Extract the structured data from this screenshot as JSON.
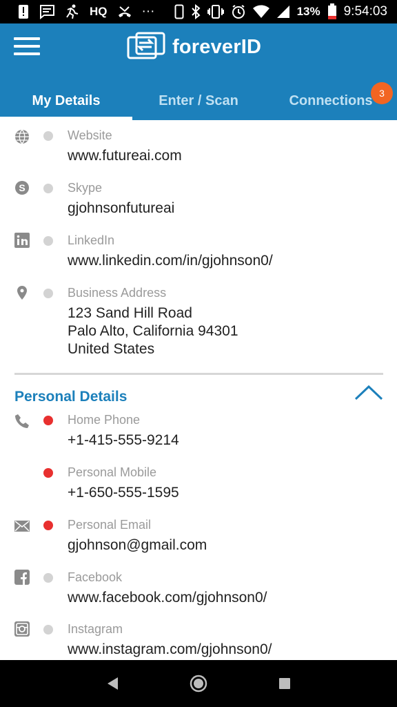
{
  "status_bar": {
    "left_icons": [
      "alert-icon",
      "message-icon",
      "activity-icon"
    ],
    "hq": "HQ",
    "ellipsis": "···",
    "battery_percent": "13%",
    "time": "9:54:03"
  },
  "app": {
    "logo_text": "foreverID",
    "brand_color": "#1c80bb",
    "tabs": [
      {
        "label": "My Details",
        "active": true
      },
      {
        "label": "Enter / Scan",
        "active": false
      },
      {
        "label": "Connections",
        "active": false
      }
    ],
    "connections_badge": "3",
    "badge_color": "#f26522"
  },
  "business": {
    "website": {
      "label": "Website",
      "value": "www.futureai.com",
      "icon": "globe-icon"
    },
    "skype": {
      "label": "Skype",
      "value": "gjohnsonfutureai",
      "icon": "skype-icon"
    },
    "linkedin": {
      "label": "LinkedIn",
      "value": "www.linkedin.com/in/gjohnson0/",
      "icon": "linkedin-icon"
    },
    "address": {
      "label": "Business Address",
      "line1": "123 Sand Hill Road",
      "line2": "Palo Alto, California 94301",
      "line3": "United States",
      "icon": "location-pin-icon"
    }
  },
  "personal": {
    "title": "Personal Details",
    "home_phone": {
      "label": "Home Phone",
      "value": "+1-415-555-9214",
      "icon": "phone-icon"
    },
    "personal_mobile": {
      "label": "Personal Mobile",
      "value": "+1-650-555-1595"
    },
    "personal_email": {
      "label": "Personal Email",
      "value": "gjohnson@gmail.com",
      "icon": "mail-icon"
    },
    "facebook": {
      "label": "Facebook",
      "value": "www.facebook.com/gjohnson0/",
      "icon": "facebook-icon"
    },
    "instagram": {
      "label": "Instagram",
      "value": "www.instagram.com/gjohnson0/",
      "icon": "instagram-icon"
    }
  }
}
